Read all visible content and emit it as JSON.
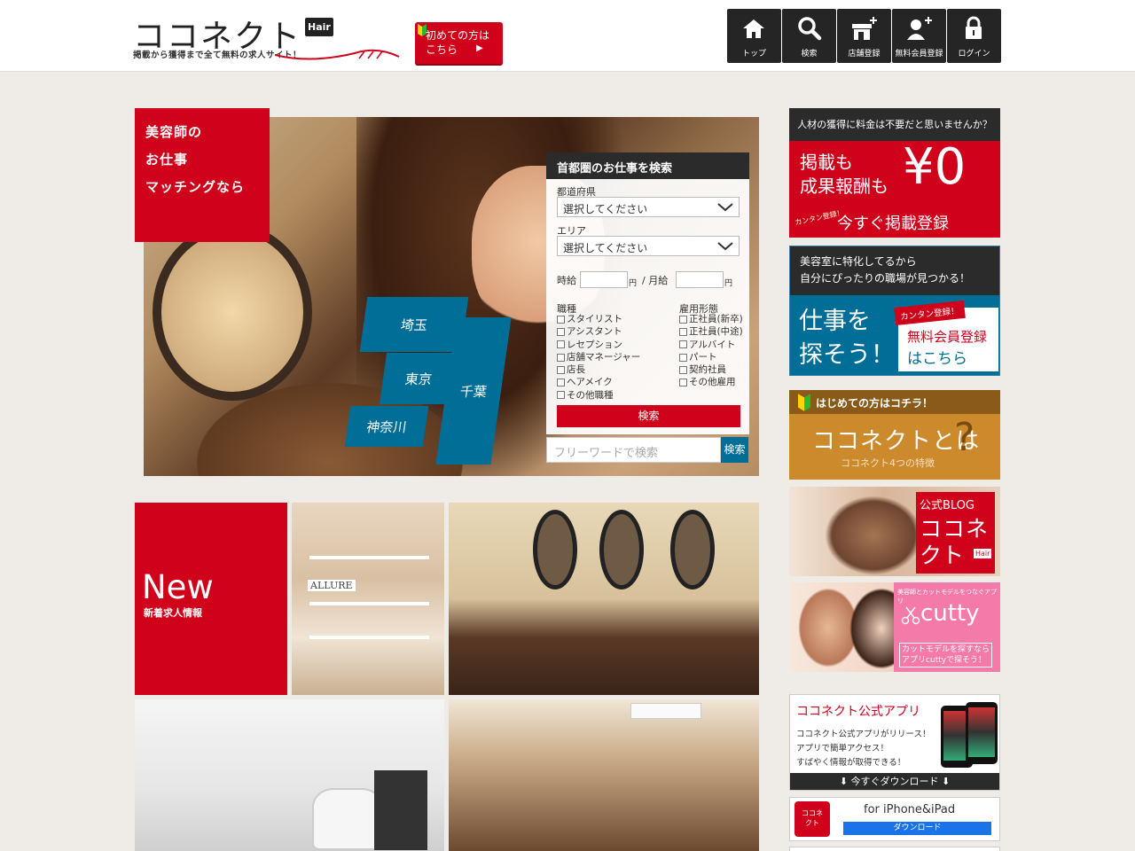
{
  "header": {
    "logo_text": "ココネクト",
    "logo_badge": "Hair",
    "tagline": "掲載から獲得まで全て無料の求人サイト！",
    "first_button": {
      "line1": "初めての方は",
      "line2": "こちら",
      "arrow": "▶"
    }
  },
  "nav": [
    {
      "label": "トップ",
      "icon": "home-icon"
    },
    {
      "label": "検索",
      "icon": "search-icon"
    },
    {
      "label": "店舗登録",
      "icon": "shop-add-icon"
    },
    {
      "label": "無料会員登録",
      "icon": "user-add-icon"
    },
    {
      "label": "ログイン",
      "icon": "lock-icon"
    }
  ],
  "hero": {
    "tag": [
      "美容師の",
      "お仕事",
      "マッチングなら"
    ],
    "regions": {
      "saitama": "埼玉",
      "tokyo": "東京",
      "kanagawa": "神奈川",
      "chiba": "千葉"
    }
  },
  "search": {
    "title": "首都圏のお仕事を検索",
    "pref_label": "都道府県",
    "pref_value": "選択してください",
    "area_label": "エリア",
    "area_value": "選択してください",
    "hourly_label": "時給",
    "monthly_label": "/ 月給",
    "yen": "円",
    "job_label": "職種",
    "jobs": [
      "スタイリスト",
      "アシスタント",
      "レセプション",
      "店舗マネージャー",
      "店長",
      "ヘアメイク",
      "その他職種"
    ],
    "employ_label": "雇用形態",
    "employ": [
      "正社員(新卒)",
      "正社員(中途)",
      "アルバイト",
      "パート",
      "契約社員",
      "その他雇用"
    ],
    "button": "検索",
    "freeword_placeholder": "フリーワードで検索",
    "freeword_button": "検索"
  },
  "new_jobs": {
    "title": "New",
    "subtitle": "新着求人情報",
    "photo_sign": "ALLURE"
  },
  "sidebar": {
    "zero": {
      "top": "人材の獲得に料金は不要だと思いませんか？",
      "line1": "掲載も",
      "line2": "成果報酬も",
      "price": "¥0",
      "badge": "カンタン登録！",
      "cta": "今すぐ掲載登録"
    },
    "member": {
      "line1": "美容室に特化してるから",
      "line2": "自分にぴったりの職場が見つかる！",
      "big1": "仕事を",
      "big2": "探そう！",
      "badge": "カンタン登録！",
      "free": "無料会員登録",
      "here": "はこちら"
    },
    "about": {
      "top": "はじめての方はコチラ！",
      "main": "ココネクトとは",
      "sub": "ココネクト4つの特徴",
      "q": "?"
    },
    "blog": {
      "l1": "公式BLOG",
      "l2": "ココネ",
      "l3": "クト",
      "badge": "Hair"
    },
    "cutty": {
      "top": "美容師とカットモデルをつなぐアプリ",
      "name": "cutty",
      "desc1": "カットモデルを探すなら",
      "desc2": "アプリcuttyで探そう！"
    },
    "app": {
      "title": "ココネクト公式アプリ",
      "d1": "ココネクト公式アプリがリリース！",
      "d2": "アプリで簡単アクセス！",
      "d3": "すばやく情報が取得できる！",
      "download": "⬇ 今すぐダウンロード ⬇"
    },
    "ios": {
      "icon_l1": "ココネ",
      "icon_l2": "クト",
      "title": "for iPhone&iPad",
      "button": "ダウンロード"
    }
  }
}
